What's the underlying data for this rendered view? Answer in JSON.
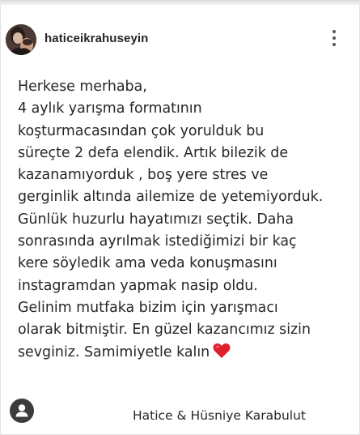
{
  "post": {
    "username": "haticeikrahuseyin",
    "caption_lines": [
      "Herkese merhaba,",
      "4 aylık yarışma formatının",
      "koşturmacasından çok yorulduk bu",
      "süreçte 2 defa elendik. Artık bilezik de",
      "kazanamıyorduk , boş yere stres ve",
      "gerginlik altında ailemize de yetemiyorduk.",
      "Günlük huzurlu hayatımızı seçtik. Daha",
      "sonrasında ayrılmak istediğimizi bir kaç",
      "kere söyledik ama veda konuşmasını",
      "instagramdan yapmak nasip oldu.",
      "Gelinim mutfaka bizim için yarışmacı",
      "olarak bitmiştir. En güzel kazancımız sizin",
      "sevginiz. Samimiyetle kalın"
    ],
    "signature": "Hatice & Hüsniye Karabulut",
    "icons": {
      "more": "more-vertical-icon",
      "heart": "red-heart-emoji",
      "profile": "profile-avatar-icon"
    },
    "colors": {
      "text": "#262626",
      "heart": "#e0202d",
      "icon": "#555555"
    }
  }
}
